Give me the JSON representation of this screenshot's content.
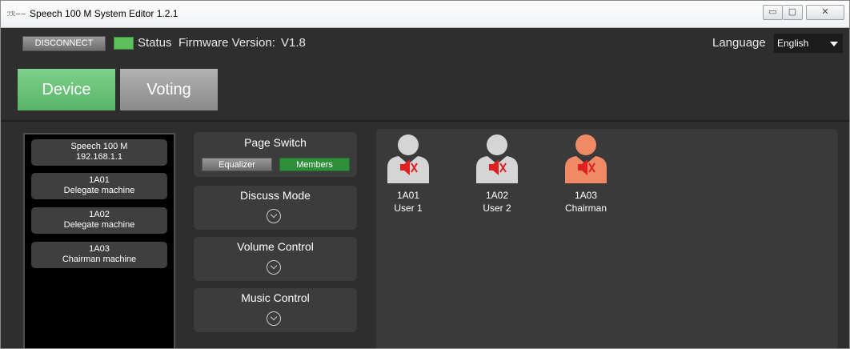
{
  "window": {
    "title": "Speech 100 M System Editor 1.2.1",
    "controls": {
      "minimize": "▭",
      "maximize": "▢",
      "close": "✕"
    }
  },
  "toolbar": {
    "disconnect_label": "DISCONNECT",
    "status_label": "Status",
    "status_color": "#5cc05c",
    "firmware_label": "Firmware Version:",
    "firmware_value": "V1.8",
    "language_label": "Language",
    "language_value": "English"
  },
  "tabs": [
    {
      "label": "Device",
      "active": true,
      "color": "#66c073"
    },
    {
      "label": "Voting",
      "active": false,
      "color": "#9e9e9e"
    }
  ],
  "devices": [
    {
      "line1": "Speech 100 M",
      "line2": "192.168.1.1"
    },
    {
      "line1": "1A01",
      "line2": "Delegate machine"
    },
    {
      "line1": "1A02",
      "line2": "Delegate machine"
    },
    {
      "line1": "1A03",
      "line2": "Chairman machine"
    }
  ],
  "controls_panel": {
    "page_switch": {
      "title": "Page Switch",
      "equalizer": "Equalizer",
      "members": "Members"
    },
    "discuss_mode": "Discuss Mode",
    "volume_control": "Volume Control",
    "music_control": "Music Control"
  },
  "members": [
    {
      "id": "1A01",
      "name": "User 1",
      "role": "delegate",
      "color": "#d5d5d5",
      "muted": true
    },
    {
      "id": "1A02",
      "name": "User 2",
      "role": "delegate",
      "color": "#d5d5d5",
      "muted": true
    },
    {
      "id": "1A03",
      "name": "Chairman",
      "role": "chairman",
      "color": "#f08a66",
      "muted": true
    }
  ]
}
